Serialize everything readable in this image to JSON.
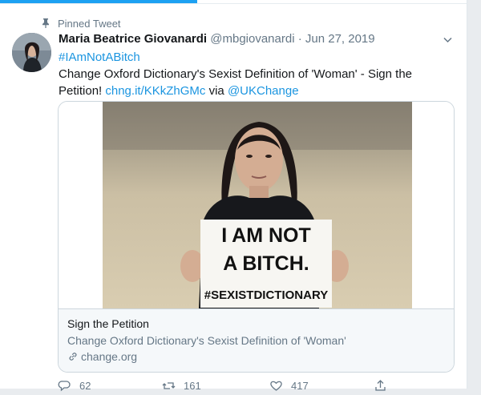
{
  "pinned_label": "Pinned Tweet",
  "author": {
    "name": "Maria Beatrice Giovanardi",
    "handle": "@mbgiovanardi",
    "separator": "·",
    "date": "Jun 27, 2019"
  },
  "tweet": {
    "hashtag": "#IAmNotABitch",
    "line1": "Change Oxford Dictionary's Sexist Definition of 'Woman' - Sign the",
    "line2_prefix": "Petition! ",
    "short_link": "chng.it/KKkZhGMc",
    "via": " via ",
    "mention": "@UKChange"
  },
  "card": {
    "sign_lines": [
      "I AM NOT",
      "A BITCH.",
      "#SEXISTDICTIONARY"
    ],
    "title": "Sign the Petition",
    "description": "Change Oxford Dictionary's Sexist Definition of 'Woman'",
    "domain": "change.org"
  },
  "actions": {
    "reply_count": "62",
    "retweet_count": "161",
    "like_count": "417"
  },
  "colors": {
    "link": "#1b95e0",
    "muted": "#657786",
    "accent": "#1da1f2"
  },
  "icons": [
    "pin-icon",
    "caret-down-icon",
    "link-icon",
    "reply-icon",
    "retweet-icon",
    "like-icon",
    "share-icon"
  ]
}
